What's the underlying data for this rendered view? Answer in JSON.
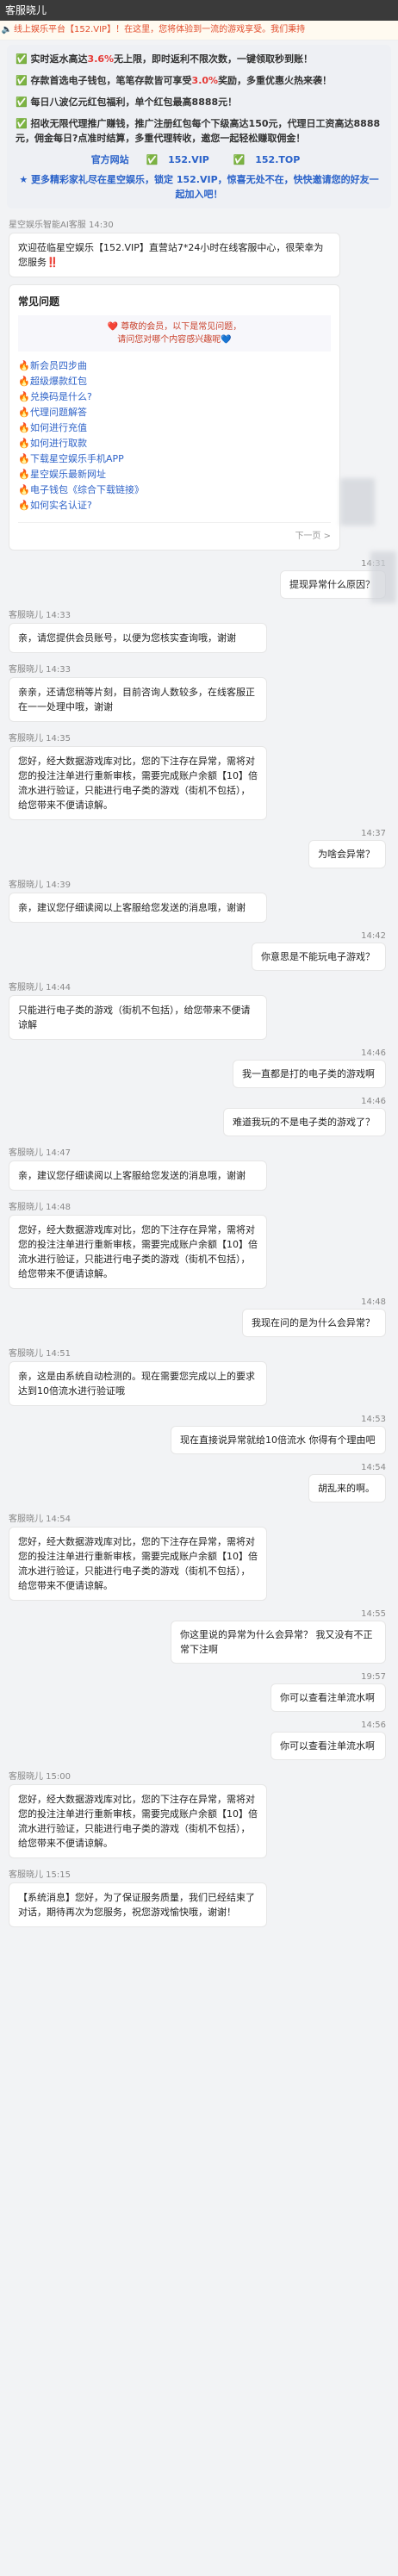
{
  "header": {
    "title": "客服晓儿"
  },
  "notice": {
    "text": "线上娱乐平台【152.VIP】！在这里，您将体验到一流的游戏享受。我们秉持"
  },
  "banner": {
    "lines": [
      {
        "icon": "✅",
        "prefix": "实时返水高达",
        "highlight": "3.6%",
        "suffix": "无上限，即时返利不限次数，一键领取秒到账！"
      },
      {
        "icon": "✅",
        "prefix": "存款首选电子钱包，笔笔存款皆可享受",
        "highlight": "3.0%",
        "suffix": "奖励，多重优惠火热来袭！"
      },
      {
        "icon": "✅",
        "prefix": "每日八波亿元红包福利，单个红包最高8888元！",
        "highlight": "",
        "suffix": ""
      },
      {
        "icon": "✅",
        "prefix": "招收无限代理推广赚钱，推广注册红包每个下级高达150元，代理日工资高达8888元，佣金每日?点准时结算，多重代理转收，邀您一起轻松赚取佣金！",
        "highlight": "",
        "suffix": ""
      }
    ],
    "links_label": "官方网站",
    "link1": "152.VIP",
    "link2": "152.TOP",
    "tail": "★ 更多精彩家礼尽在星空娱乐，锁定 152.VIP，惊喜无处不在，快快邀请您的好友一起加入吧！"
  },
  "chat": {
    "agent_name": "客服晓儿",
    "intro_sender": "星空娱乐智能AI客服 14:30",
    "welcome": "欢迎莅临星空娱乐【152.VIP】直营站7*24小时在线客服中心，很荣幸为您服务‼️",
    "faq": {
      "title": "常见问题",
      "hint_line1": "❤️ 尊敬的会员，以下是常见问题，",
      "hint_line2": "请问您对哪个内容感兴趣呢💙",
      "items": [
        "新会员四步曲",
        "超级爆款红包",
        "兑换码是什么?",
        "代理问题解答",
        "如何进行充值",
        "如何进行取款",
        "下载星空娱乐手机APP",
        "星空娱乐最新网址",
        "电子钱包《综合下载链接》",
        "如何实名认证?"
      ],
      "next": "下一页 >"
    },
    "messages": [
      {
        "side": "right",
        "time": "14:31",
        "text": "提现异常什么原因？"
      },
      {
        "side": "left",
        "sender": "客服晓儿 14:33",
        "text": "亲，请您提供会员账号，以便为您核实查询哦，谢谢"
      },
      {
        "side": "left",
        "sender": "客服晓儿 14:33",
        "text": "亲亲，还请您稍等片刻，目前咨询人数较多，在线客服正在一一处理中哦，谢谢"
      },
      {
        "side": "left",
        "sender": "客服晓儿 14:35",
        "text": "您好，经大数据游戏库对比，您的下注存在异常，需将对您的投注注单进行重新审核，需要完成账户余额【10】倍流水进行验证，只能进行电子类的游戏（街机不包括），给您带来不便请谅解。"
      },
      {
        "side": "right",
        "time": "14:37",
        "text": "为啥会异常？"
      },
      {
        "side": "left",
        "sender": "客服晓儿 14:39",
        "text": "亲，建议您仔细读阅以上客服给您发送的消息哦，谢谢"
      },
      {
        "side": "right",
        "time": "14:42",
        "text": "你意思是不能玩电子游戏？"
      },
      {
        "side": "left",
        "sender": "客服晓儿 14:44",
        "text": "只能进行电子类的游戏（街机不包括），给您带来不便请谅解"
      },
      {
        "side": "right",
        "time": "14:46",
        "text": "我一直都是打的电子类的游戏啊"
      },
      {
        "side": "right",
        "time": "14:46",
        "text": "难道我玩的不是电子类的游戏了？"
      },
      {
        "side": "left",
        "sender": "客服晓儿 14:47",
        "text": "亲，建议您仔细读阅以上客服给您发送的消息哦，谢谢"
      },
      {
        "side": "left",
        "sender": "客服晓儿 14:48",
        "text": "您好，经大数据游戏库对比，您的下注存在异常，需将对您的投注注单进行重新审核，需要完成账户余额【10】倍流水进行验证，只能进行电子类的游戏（街机不包括），给您带来不便请谅解。"
      },
      {
        "side": "right",
        "time": "14:48",
        "text": "我现在问的是为什么会异常？"
      },
      {
        "side": "left",
        "sender": "客服晓儿 14:51",
        "text": "亲，这是由系统自动检测的。现在需要您完成以上的要求达到10倍流水进行验证哦"
      },
      {
        "side": "right",
        "time": "14:53",
        "text": "现在直接说异常就给10倍流水 你得有个理由吧"
      },
      {
        "side": "right",
        "time": "14:54",
        "text": "胡乱来的啊。"
      },
      {
        "side": "left",
        "sender": "客服晓儿 14:54",
        "text": "您好，经大数据游戏库对比，您的下注存在异常，需将对您的投注注单进行重新审核，需要完成账户余额【10】倍流水进行验证，只能进行电子类的游戏（街机不包括），给您带来不便请谅解。"
      },
      {
        "side": "right",
        "time": "14:55",
        "text": "你这里说的异常为什么会异常？ 我又没有不正常下注啊"
      },
      {
        "side": "right",
        "time": "19:57",
        "text": "你可以查看注单流水啊"
      },
      {
        "side": "right",
        "time": "14:56",
        "text": "你可以查看注单流水啊"
      },
      {
        "side": "left",
        "sender": "客服晓儿 15:00",
        "text": "您好，经大数据游戏库对比，您的下注存在异常，需将对您的投注注单进行重新审核，需要完成账户余额【10】倍流水进行验证，只能进行电子类的游戏（街机不包括），给您带来不便请谅解。"
      },
      {
        "side": "left",
        "sender": "客服晓儿 15:15",
        "text": "【系统消息】您好，为了保证服务质量，我们已经结束了对话，期待再次为您服务，祝您游戏愉快哦，谢谢！"
      }
    ]
  }
}
